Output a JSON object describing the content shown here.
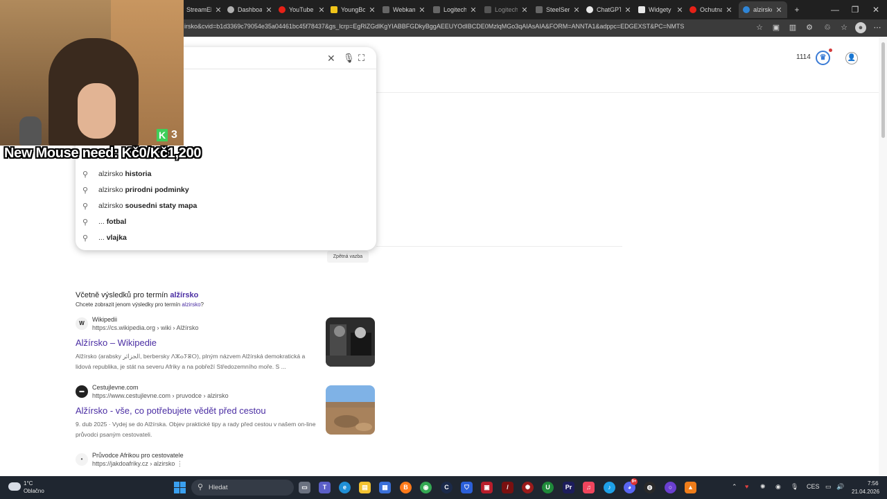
{
  "tabs": [
    {
      "title": "StreamEle",
      "color": "#2d6cdf"
    },
    {
      "title": "Dashboar",
      "color": "#b0b0b0"
    },
    {
      "title": "YouTube |",
      "color": "#e62117"
    },
    {
      "title": "YoungBoy",
      "color": "#f0c419"
    },
    {
      "title": "Webkame",
      "color": "#444444"
    },
    {
      "title": "Logitech |",
      "color": "#555555"
    },
    {
      "title": "Logitech",
      "color": "#555555"
    },
    {
      "title": "SteelSerie",
      "color": "#444444"
    },
    {
      "title": "ChatGPT",
      "color": "#e8e8e8"
    },
    {
      "title": "Widgety |",
      "color": "#e8e8e8"
    },
    {
      "title": "Ochutnal",
      "color": "#e62117"
    },
    {
      "title": "alzirsko -",
      "color": "#2f86d8"
    }
  ],
  "address_bar": {
    "url": "irsko&cvid=b1d3369c79054e35a04461bc45f78437&gs_lcrp=EgRlZGdlKgYIABBFGDkyBggAEEUYOdIBCDE0MzlqMGo3qAIAsAIA&FORM=ANNTA1&adppc=EDGEXST&PC=NMTS"
  },
  "header": {
    "points": "1114"
  },
  "suggestions": [
    {
      "prefix": "alzirsko",
      "bold": "historia"
    },
    {
      "prefix": "alzirsko",
      "bold": "prirodni podminky"
    },
    {
      "prefix": "alzirsko",
      "bold": "sousedni staty mapa"
    },
    {
      "prefix": "...",
      "bold": "fotbal"
    },
    {
      "prefix": "...",
      "bold": "vlajka"
    }
  ],
  "feedback_label": "Zpětná vazba",
  "spelling": {
    "including_prefix": "Včetně výsledků pro termín",
    "including_term": "alžírsko",
    "only_prefix": "Chcete zobrazit jenom výsledky pro termín",
    "only_term": "alzirsko",
    "only_suffix": "?"
  },
  "results": [
    {
      "site": "Wikipedii",
      "url": "https://cs.wikipedia.org › wiki › Alžírsko",
      "title": "Alžírsko – Wikipedie",
      "snippet": "Alžírsko (arabsky الجزائر, berbersky ⴷⵣⴰⵢⴻⵔ), plným názvem Alžírská demokratická a lidová republika, je stát na severu Afriky a na pobřeží Středozemního moře. S ..."
    },
    {
      "site": "Cestujlevne.com",
      "url": "https://www.cestujlevne.com › pruvodce › alzirsko",
      "title": "Alžírsko - vše, co potřebujete vědět před cestou",
      "snippet": "9. dub 2025 · Vydej se do Alžírska. Objev praktické tipy a rady před cestou v našem on-line průvodci psaným cestovateli."
    },
    {
      "site": "Průvodce Afrikou pro cestovatele",
      "url": "https://jakdoafriky.cz › alzirsko ⋮",
      "title": "",
      "snippet": ""
    }
  ],
  "overlay": {
    "badge_letter": "K",
    "badge_count": "3",
    "donation_text": "New Mouse need: Kč0/Kč1,200"
  },
  "taskbar": {
    "temp": "1°C",
    "weather": "Oblačno",
    "search_placeholder": "Hledat",
    "language": "CES",
    "time": "7:56",
    "date": "21.04.2026",
    "badge_count": "9+"
  }
}
